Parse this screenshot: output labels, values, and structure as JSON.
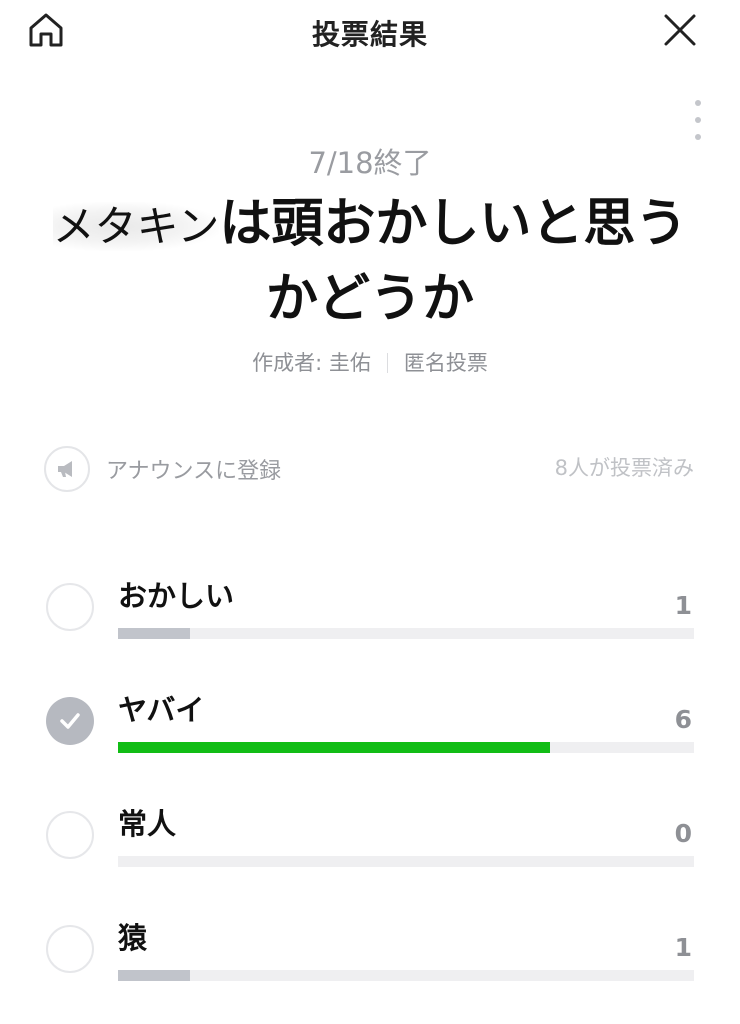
{
  "header": {
    "title": "投票結果",
    "home_icon": "home-icon",
    "close_icon": "close-icon"
  },
  "more_icon": "more-vertical-icon",
  "poll": {
    "end_date": "7/18終了",
    "question_name": "メタキン",
    "question_line1_rest": "は頭おかしいと思う",
    "question_line2": "かどうか",
    "author": "作成者: 圭佑",
    "anonymity": "匿名投票"
  },
  "announce": {
    "label": "アナウンスに登録",
    "icon": "megaphone-icon"
  },
  "voters_text": "8人が投票済み",
  "colors": {
    "accent_green": "#11bd15",
    "bar_gray": "#c1c4cb",
    "track": "#efeff1"
  },
  "options": [
    {
      "label": "おかしい",
      "count": "1",
      "fraction": 0.125,
      "checked": false
    },
    {
      "label": "ヤバイ",
      "count": "6",
      "fraction": 0.75,
      "checked": true
    },
    {
      "label": "常人",
      "count": "0",
      "fraction": 0,
      "checked": false
    },
    {
      "label": "猿",
      "count": "1",
      "fraction": 0.125,
      "checked": false
    }
  ]
}
